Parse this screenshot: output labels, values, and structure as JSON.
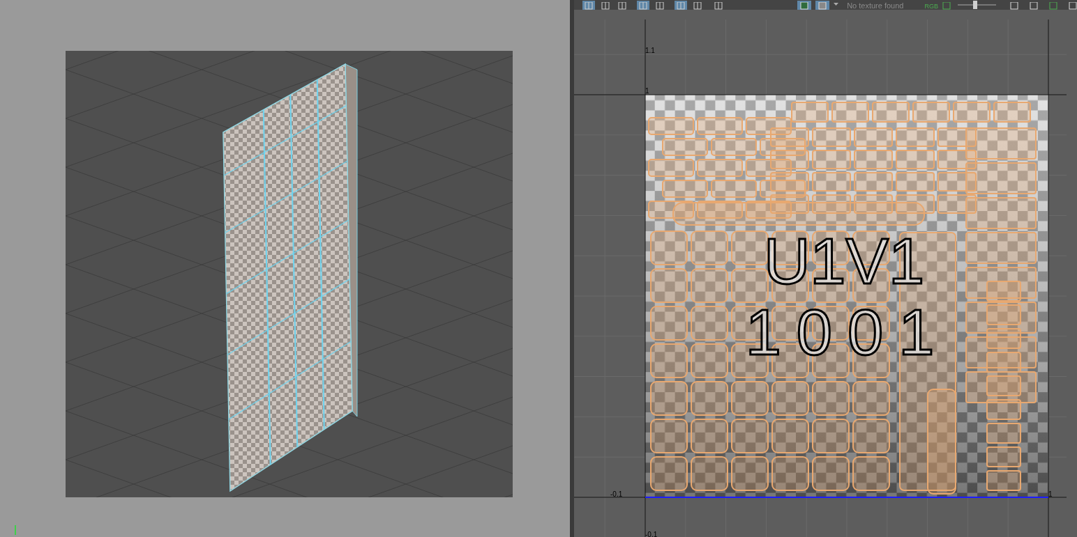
{
  "uv_toolbar": {
    "buttons": [
      {
        "selected": true
      },
      {
        "selected": false
      },
      {
        "selected": false
      },
      {
        "selected": true
      },
      {
        "selected": false
      },
      {
        "selected": true
      },
      {
        "selected": false
      },
      {
        "selected": false
      }
    ],
    "texture_toggles": [
      {
        "selected": true
      },
      {
        "selected": true
      }
    ],
    "texture_field": "No texture found",
    "channel_label": "RGB",
    "exposure": {
      "level": 0.45
    }
  },
  "uv_editor": {
    "axis_labels": [
      {
        "text": "1.1"
      },
      {
        "text": "1"
      },
      {
        "text": "-0.1"
      },
      {
        "text": "-0.1"
      },
      {
        "text": "1"
      }
    ],
    "tile_label": "U1V1",
    "tile_number": "1001"
  }
}
